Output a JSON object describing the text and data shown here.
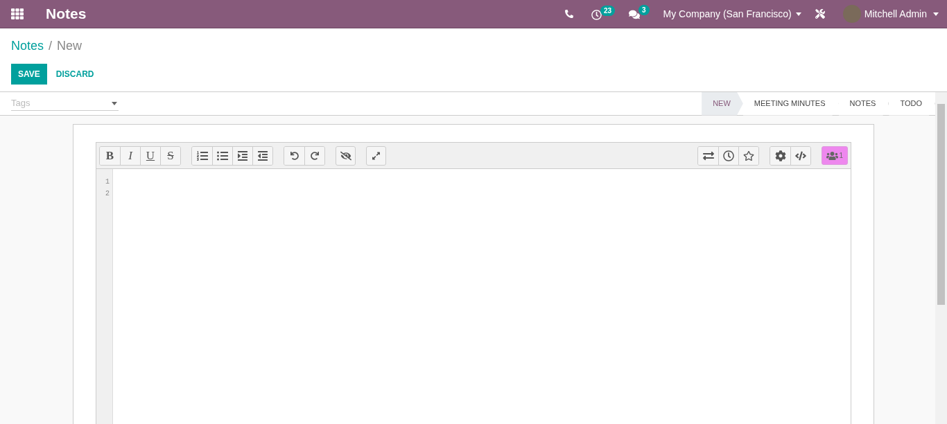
{
  "navbar": {
    "app_title": "Notes",
    "activity_count": "23",
    "message_count": "3",
    "company": "My Company (San Francisco)",
    "user": "Mitchell Admin"
  },
  "breadcrumb": {
    "parent": "Notes",
    "separator": "/",
    "current": "New"
  },
  "buttons": {
    "save": "SAVE",
    "discard": "DISCARD"
  },
  "tags": {
    "placeholder": "Tags"
  },
  "stages": [
    {
      "label": "NEW",
      "selected": true
    },
    {
      "label": "MEETING MINUTES",
      "selected": false
    },
    {
      "label": "NOTES",
      "selected": false
    },
    {
      "label": "TODO",
      "selected": false
    }
  ],
  "editor": {
    "format_buttons": [
      {
        "kind": "bold",
        "label": "B"
      },
      {
        "kind": "italic",
        "label": "I"
      },
      {
        "kind": "underline",
        "label": "U"
      },
      {
        "kind": "strike",
        "label": "S"
      }
    ],
    "collaborators": "1",
    "line_numbers": [
      "1",
      "2"
    ]
  }
}
